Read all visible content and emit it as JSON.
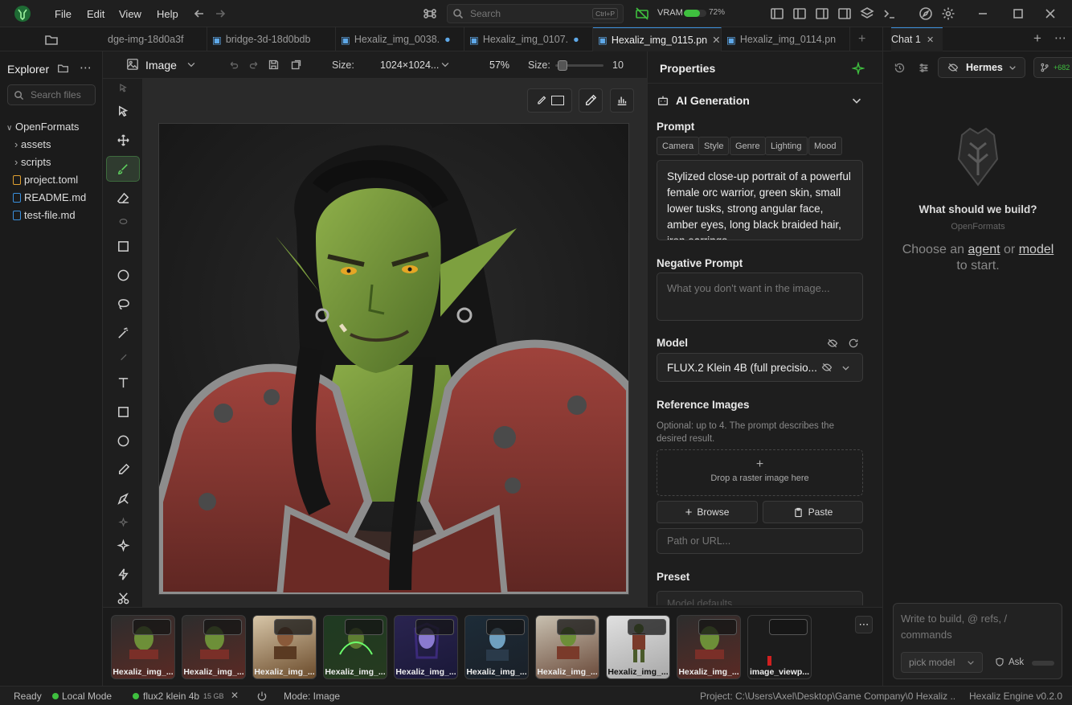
{
  "menu": {
    "file": "File",
    "edit": "Edit",
    "view": "View",
    "help": "Help"
  },
  "search": {
    "placeholder": "Search",
    "shortcut": "Ctrl+P"
  },
  "vram": {
    "label": "VRAM",
    "percent": "72%",
    "fraction": 0.72
  },
  "explorer": {
    "title": "Explorer",
    "search_placeholder": "Search files",
    "root": "OpenFormats",
    "items": [
      "assets",
      "scripts",
      "project.toml",
      "README.md",
      "test-file.md"
    ]
  },
  "tabs": [
    "dge-img-18d0a3f",
    "bridge-3d-18d0bdb",
    "Hexaliz_img_0038.",
    "Hexaliz_img_0107.",
    "Hexaliz_img_0115.pn",
    "Hexaliz_img_0114.pn"
  ],
  "toolbar": {
    "mode": "Image",
    "size_label": "Size:",
    "size_value": "1024×1024...",
    "zoom": "57%",
    "brush_label": "Size:",
    "brush_value": "10"
  },
  "properties": {
    "title": "Properties",
    "section": "AI Generation",
    "prompt_label": "Prompt",
    "chips": [
      "Camera",
      "Style",
      "Genre",
      "Lighting",
      "Mood"
    ],
    "prompt_text": "Stylized close-up portrait of a powerful female orc warrior, green skin, small lower tusks, strong angular face, amber eyes, long black braided hair, iron earrings",
    "negative_label": "Negative Prompt",
    "negative_placeholder": "What you don't want in the image...",
    "model_label": "Model",
    "model_value": "FLUX.2 Klein 4B (full precisio...",
    "ref_label": "Reference Images",
    "ref_help": "Optional: up to 4. The prompt describes the desired result.",
    "drop_text": "Drop a raster image here",
    "browse": "Browse",
    "paste": "Paste",
    "path_placeholder": "Path or URL...",
    "preset_label": "Preset",
    "preset_value": "Model defaults"
  },
  "chat": {
    "tab": "Chat 1",
    "agent": "Hermes",
    "badge": "+682",
    "headline": "What should we build?",
    "sub": "OpenFormats",
    "choose_pre": "Choose an",
    "agent_link": "agent",
    "or": "or",
    "model_link": "model",
    "to_start": "to start.",
    "input_placeholder": "Write to build, @ refs, / commands",
    "pick_model": "pick model",
    "ask": "Ask"
  },
  "filmstrip": [
    "Hexaliz_img_...",
    "Hexaliz_img_...",
    "Hexaliz_img_...",
    "Hexaliz_img_...",
    "Hexaliz_img_...",
    "Hexaliz_img_...",
    "Hexaliz_img_...",
    "Hexaliz_img_...",
    "Hexaliz_img_...",
    "image_viewp..."
  ],
  "status": {
    "ready": "Ready",
    "local": "Local Mode",
    "model": "flux2 klein 4b",
    "model_size": "15 GB",
    "mode": "Mode: Image",
    "project": "Project: C:\\Users\\Axel\\Desktop\\Game Company\\0 Hexaliz ...",
    "engine": "Hexaliz Engine v0.2.0"
  },
  "colors": {
    "accent": "#3fbf3f",
    "link": "#3a8fdc",
    "bg": "#1a1a1a"
  }
}
